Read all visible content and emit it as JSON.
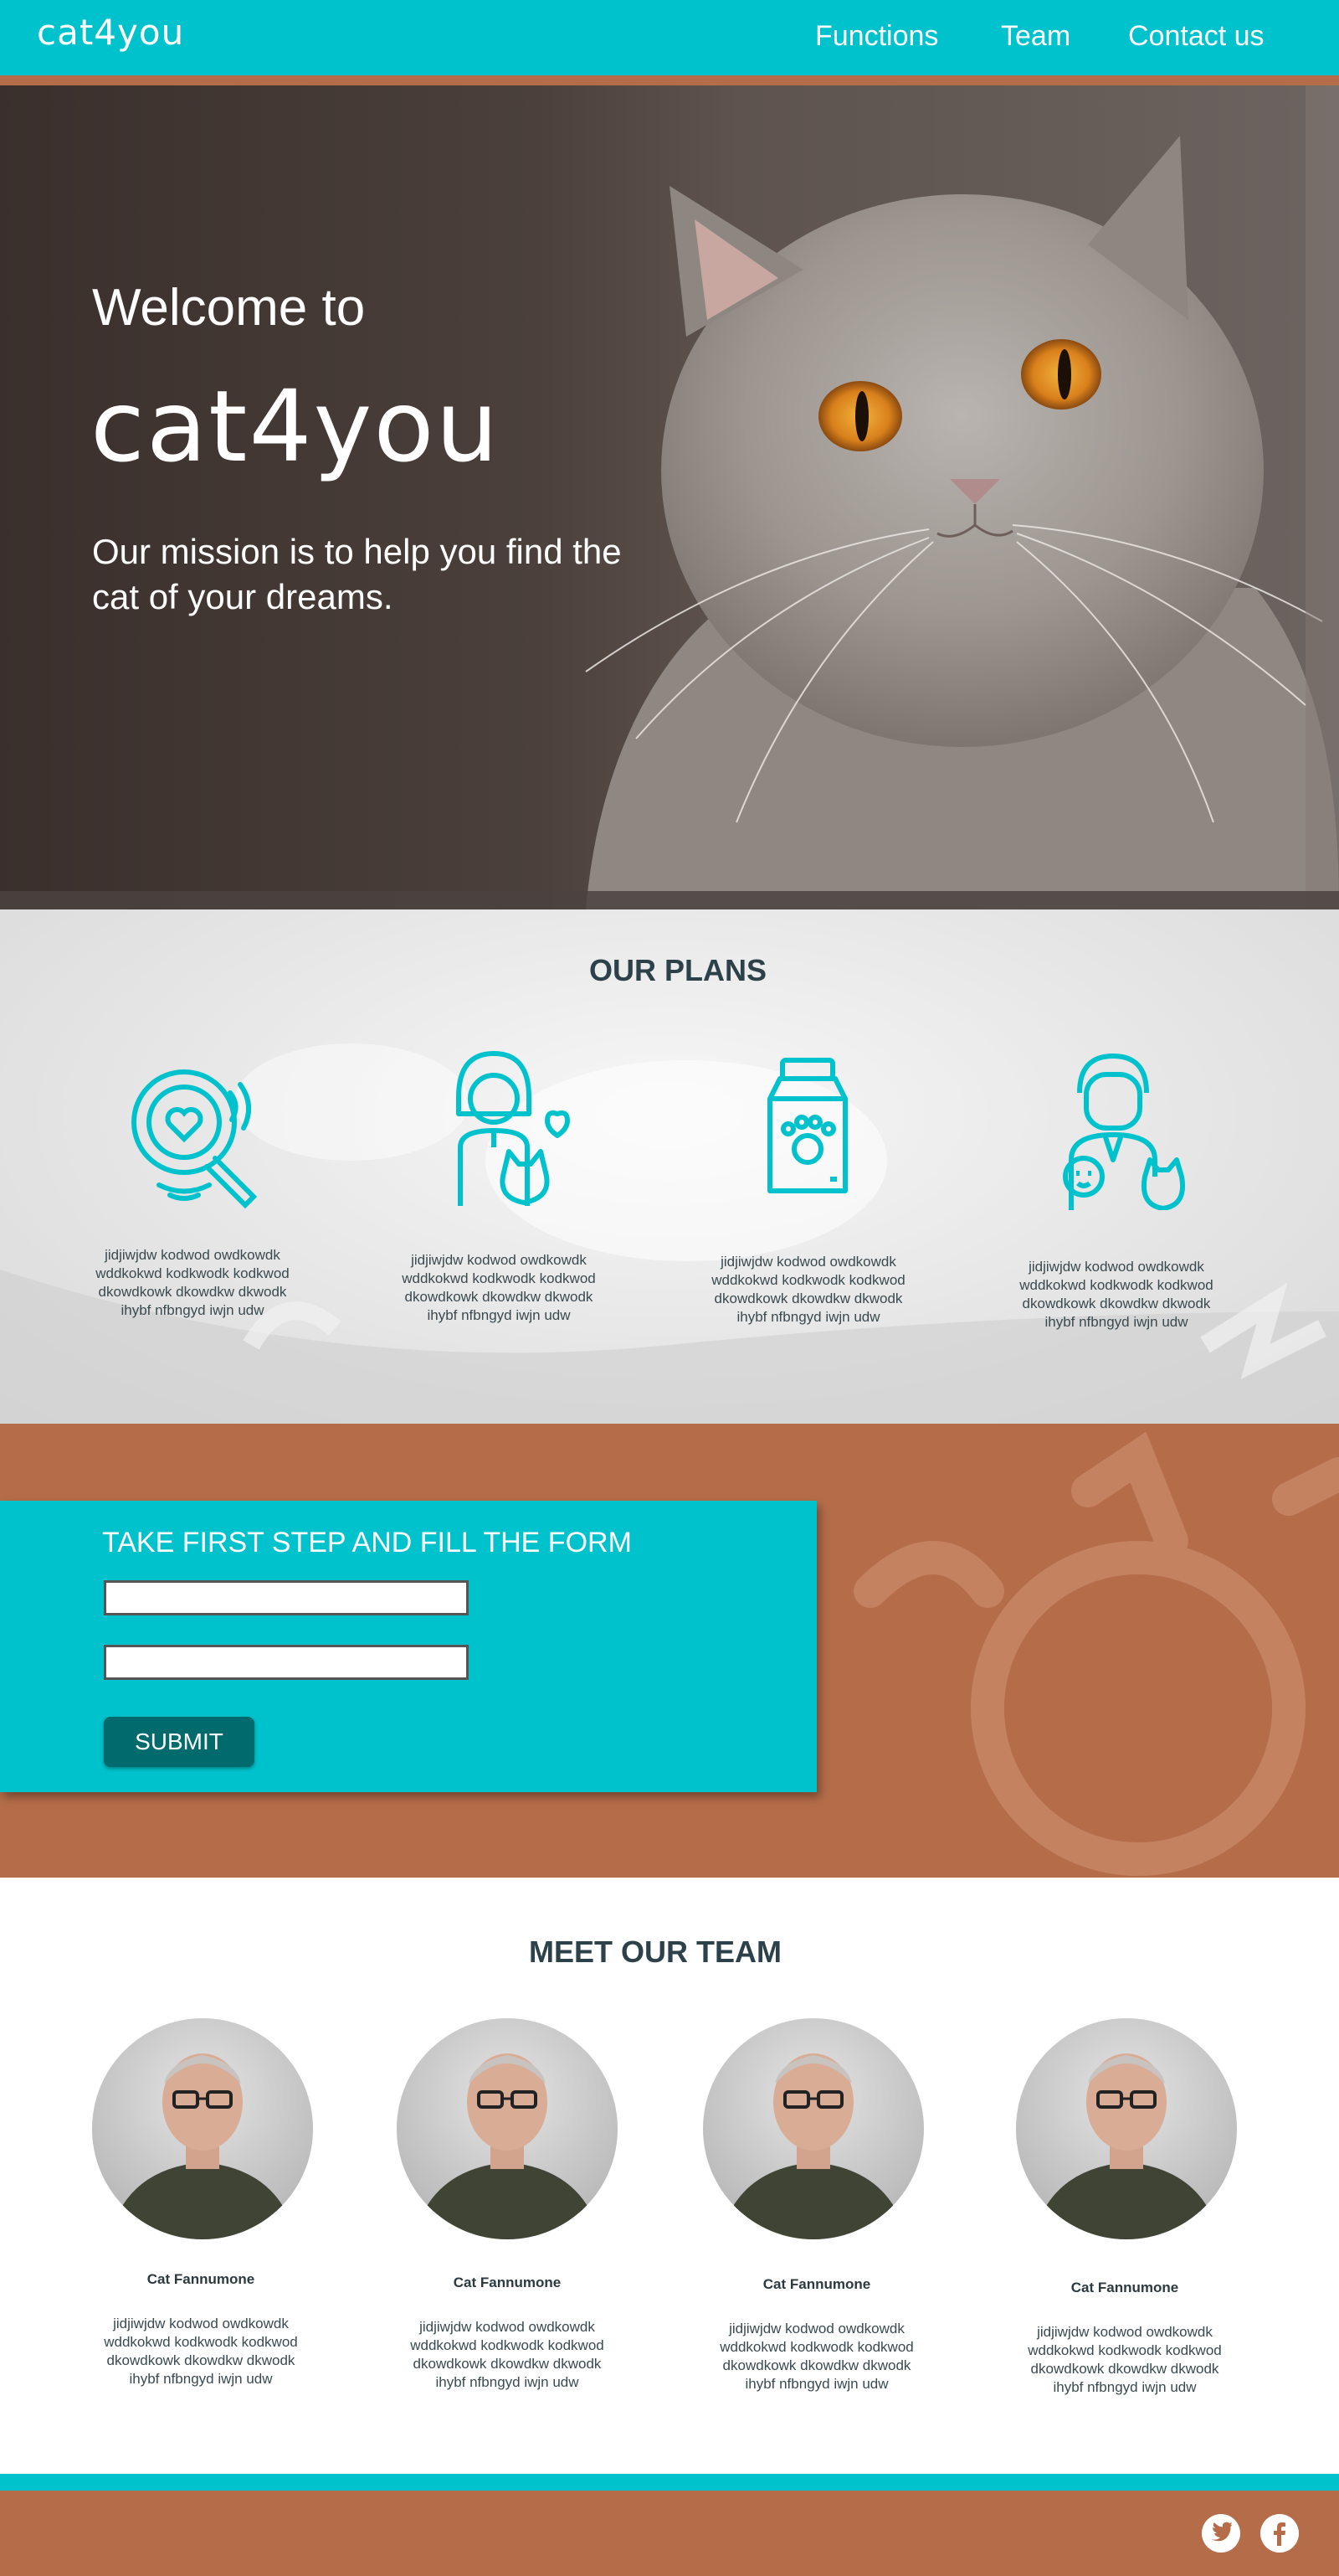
{
  "header": {
    "logo": "cat4you",
    "nav": [
      "Functions",
      "Team",
      "Contact us"
    ]
  },
  "hero": {
    "welcome": "Welcome to",
    "brand": "cat4you",
    "mission": "Our mission is to help you find the cat of your dreams."
  },
  "plans": {
    "title": "OUR PLANS",
    "items": [
      {
        "icon": "search-heart-icon",
        "text": "jidjiwjdw kodwod owdkowdk wddkokwd kodkwodk kodkwod dkowdkowk dkowdkw dkwodk ihybf  nfbngyd iwjn udw"
      },
      {
        "icon": "person-with-cat-icon",
        "text": "jidjiwjdw kodwod owdkowdk wddkokwd kodkwodk kodkwod dkowdkowk dkowdkw dkwodk ihybf  nfbngyd iwjn udw"
      },
      {
        "icon": "cat-food-icon",
        "text": "jidjiwjdw kodwod owdkowdk wddkokwd kodkwodk kodkwod dkowdkowk dkowdkw dkwodk ihybf  nfbngyd iwjn udw"
      },
      {
        "icon": "vet-with-pets-icon",
        "text": "jidjiwjdw kodwod owdkowdk wddkokwd kodkwodk kodkwod dkowdkowk dkowdkw dkwodk ihybf  nfbngyd iwjn udw"
      }
    ]
  },
  "form": {
    "title": "TAKE FIRST STEP AND FILL THE FORM",
    "field1_value": "",
    "field2_value": "",
    "submit_label": "SUBMIT"
  },
  "team": {
    "title": "MEET OUR TEAM",
    "members": [
      {
        "name": "Cat Fannumone",
        "text": "jidjiwjdw kodwod owdkowdk wddkokwd kodkwodk kodkwod dkowdkowk dkowdkw dkwodk ihybf  nfbngyd iwjn udw"
      },
      {
        "name": "Cat Fannumone",
        "text": "jidjiwjdw kodwod owdkowdk wddkokwd kodkwodk kodkwod dkowdkowk dkowdkw dkwodk ihybf  nfbngyd iwjn udw"
      },
      {
        "name": "Cat Fannumone",
        "text": "jidjiwjdw kodwod owdkowdk wddkokwd kodkwodk kodkwod dkowdkowk dkowdkw dkwodk ihybf  nfbngyd iwjn udw"
      },
      {
        "name": "Cat Fannumone",
        "text": "jidjiwjdw kodwod owdkowdk wddkokwd kodkwodk kodkwod dkowdkowk dkowdkw dkwodk ihybf  nfbngyd iwjn udw"
      }
    ]
  },
  "footer": {
    "social": [
      "twitter-icon",
      "facebook-icon"
    ]
  },
  "colors": {
    "primary": "#00c2cc",
    "accent": "#b56d49",
    "dark_teal": "#006a6d",
    "title_text": "#2c4149"
  }
}
